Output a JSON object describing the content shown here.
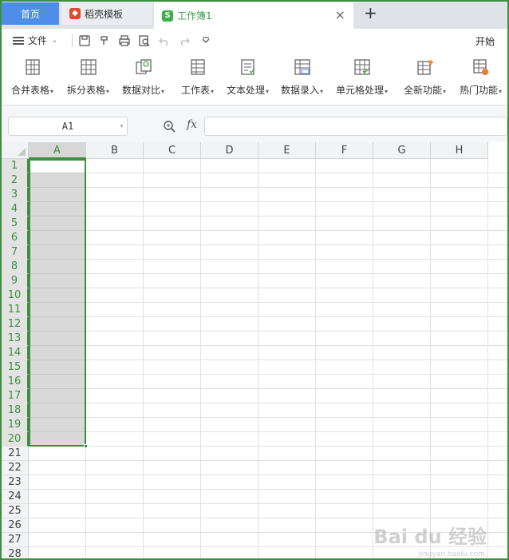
{
  "tabs": {
    "home": "首页",
    "template": "稻壳模板",
    "document": "工作簿1",
    "close": "×",
    "add": "+"
  },
  "menu": {
    "file": "文件",
    "start": "开始"
  },
  "ribbon": [
    {
      "label": "合并表格",
      "icon": "merge-table-icon"
    },
    {
      "label": "拆分表格",
      "icon": "split-table-icon"
    },
    {
      "label": "数据对比",
      "icon": "data-compare-icon"
    },
    {
      "label": "工作表",
      "icon": "worksheet-icon"
    },
    {
      "label": "文本处理",
      "icon": "text-process-icon"
    },
    {
      "label": "数据录入",
      "icon": "data-entry-icon"
    },
    {
      "label": "单元格处理",
      "icon": "cell-process-icon"
    },
    {
      "label": "全新功能",
      "icon": "new-feature-icon"
    },
    {
      "label": "热门功能",
      "icon": "hot-feature-icon"
    }
  ],
  "formula_bar": {
    "name_box": "A1",
    "fx": "fx",
    "formula": ""
  },
  "grid": {
    "columns": [
      "A",
      "B",
      "C",
      "D",
      "E",
      "F",
      "G",
      "H"
    ],
    "rows": [
      "1",
      "2",
      "3",
      "4",
      "5",
      "6",
      "7",
      "8",
      "9",
      "10",
      "11",
      "12",
      "13",
      "14",
      "15",
      "16",
      "17",
      "18",
      "19",
      "20",
      "21",
      "22",
      "23",
      "24",
      "25",
      "26",
      "27",
      "28"
    ],
    "selected_column": "A",
    "selected_rows": "1-20"
  },
  "watermark": {
    "main": "Bai du 经验",
    "sub": "jingyan.baidu.com"
  },
  "colors": {
    "accent": "#3d8f3d",
    "home_tab": "#4f8ee8",
    "selection_fill": "#d9d9d9"
  }
}
